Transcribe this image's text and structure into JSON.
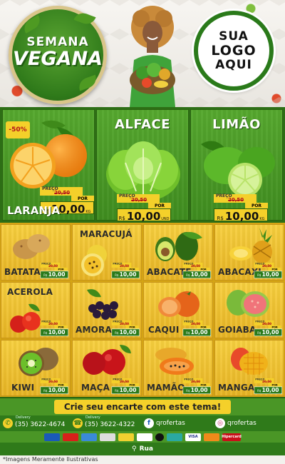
{
  "header": {
    "badge_line1": "SEMANA",
    "badge_line2": "VEGANA",
    "logo_lines": [
      "SUA",
      "LOGO",
      "AQUI"
    ]
  },
  "featured": [
    {
      "name": "LARANJA",
      "discount": "-50%",
      "preco_label": "PREÇO",
      "old_price": "20,50",
      "por_label": "POR",
      "currency": "R$",
      "price": "10,00",
      "unit": "KG"
    },
    {
      "name": "ALFACE",
      "preco_label": "PREÇO",
      "old_price": "20,50",
      "por_label": "POR",
      "currency": "R$",
      "price": "10,00",
      "unit": "UND"
    },
    {
      "name": "LIMÃO",
      "preco_label": "PREÇO",
      "old_price": "20,50",
      "por_label": "POR",
      "currency": "R$",
      "price": "10,00",
      "unit": "KG"
    }
  ],
  "products": [
    {
      "name": "BATATA",
      "preco_label": "PREÇO",
      "old_price": "20,50",
      "por_label": "POR",
      "currency": "R$",
      "price": "10,00"
    },
    {
      "name": "MARACUJÁ",
      "preco_label": "PREÇO",
      "old_price": "20,50",
      "por_label": "POR",
      "currency": "R$",
      "price": "10,00"
    },
    {
      "name": "ABACATE",
      "preco_label": "PREÇO",
      "old_price": "20,50",
      "por_label": "POR",
      "currency": "R$",
      "price": "10,00"
    },
    {
      "name": "ABACAXI",
      "preco_label": "PREÇO",
      "old_price": "20,50",
      "por_label": "POR",
      "currency": "R$",
      "price": "10,00"
    },
    {
      "name": "ACEROLA",
      "preco_label": "PREÇO",
      "old_price": "20,50",
      "por_label": "POR",
      "currency": "R$",
      "price": "10,00"
    },
    {
      "name": "AMORA",
      "preco_label": "PREÇO",
      "old_price": "20,50",
      "por_label": "POR",
      "currency": "R$",
      "price": "10,00"
    },
    {
      "name": "CAQUI",
      "preco_label": "PREÇO",
      "old_price": "20,50",
      "por_label": "POR",
      "currency": "R$",
      "price": "10,00"
    },
    {
      "name": "GOIABA",
      "preco_label": "PREÇO",
      "old_price": "20,50",
      "por_label": "POR",
      "currency": "R$",
      "price": "10,00"
    },
    {
      "name": "KIWI",
      "preco_label": "PREÇO",
      "old_price": "20,50",
      "por_label": "POR",
      "currency": "R$",
      "price": "10,00"
    },
    {
      "name": "MAÇA",
      "preco_label": "PREÇO",
      "old_price": "20,50",
      "por_label": "POR",
      "currency": "R$",
      "price": "10,00"
    },
    {
      "name": "MAMÃO",
      "preco_label": "PREÇO",
      "old_price": "20,50",
      "por_label": "POR",
      "currency": "R$",
      "price": "10,00"
    },
    {
      "name": "MANGA",
      "preco_label": "PREÇO",
      "old_price": "20,50",
      "por_label": "POR",
      "currency": "R$",
      "price": "10,00"
    }
  ],
  "footer": {
    "cta": "Crie seu encarte com este tema!",
    "whatsapp_label": "Delivery",
    "whatsapp": "(35) 3622-4674",
    "phone_label": "Delivery",
    "phone": "(35) 3622-4322",
    "facebook": "qrofertas",
    "instagram": "qrofertas",
    "payments": [
      "",
      "",
      "",
      "",
      "",
      "",
      "",
      "",
      "VISA",
      "",
      "Hipercard"
    ],
    "address": "Rua",
    "disclaimer": "*Imagens Meramente Ilustrativas"
  },
  "colors": {
    "green_dark": "#2d6e15",
    "green": "#4a9626",
    "yellow": "#f4d02a",
    "red": "#b3121a"
  }
}
